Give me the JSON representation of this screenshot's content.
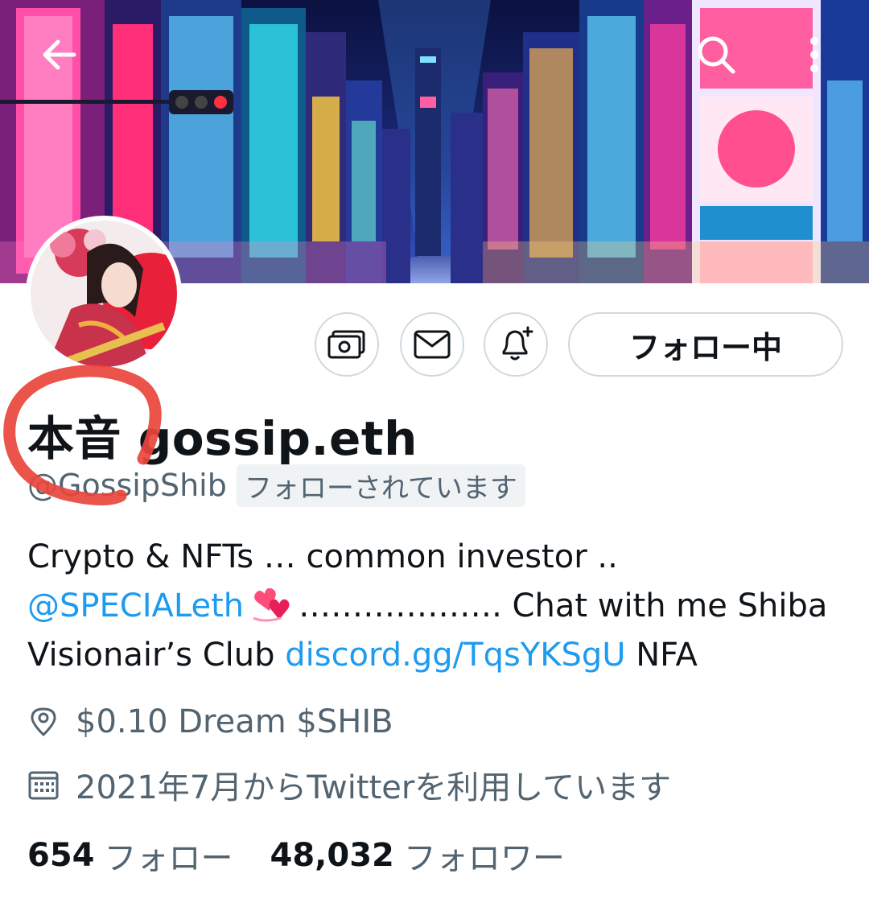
{
  "profile": {
    "display_name": "本音 gossip.eth",
    "handle": "@GossipShib",
    "follows_you": "フォローされています",
    "bio": {
      "line1": "Crypto & NFTs … common investor ..",
      "mention": "@SPECIALeth",
      "emoji": "revolving-hearts",
      "line2_rest": "………………. Chat with me Shiba",
      "line3_prefix": "Visionair’s Club",
      "link": "discord.gg/TqsYKSgU",
      "line3_suffix": "NFA"
    },
    "location": "$0.10 Dream $SHIB",
    "joined": "2021年7月からTwitterを利用しています",
    "following_count": "654",
    "following_label": "フォロー",
    "followers_count": "48,032",
    "followers_label": "フォロワー"
  },
  "actions": {
    "follow_state_label": "フォロー中"
  },
  "icons": {
    "back": "arrow-left-icon",
    "search": "search-icon",
    "more": "more-vertical-icon",
    "tip": "money-icon",
    "message": "envelope-icon",
    "notify": "bell-plus-icon",
    "location": "location-pin-icon",
    "calendar": "calendar-icon"
  },
  "colors": {
    "link": "#1d9bf0",
    "secondary_text": "#536471",
    "border": "#cfd9de",
    "annotation": "#e8453c"
  }
}
